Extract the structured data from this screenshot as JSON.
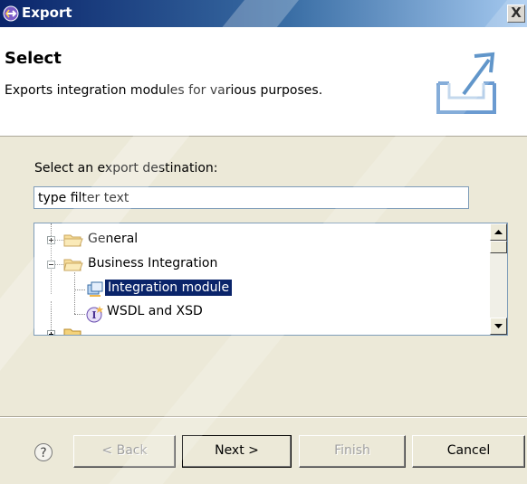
{
  "window": {
    "title": "Export",
    "close_label": "X"
  },
  "banner": {
    "title": "Select",
    "description": "Exports integration modules for various purposes."
  },
  "destination": {
    "label": "Select an export destination:",
    "filter_value": "type filter text"
  },
  "tree": {
    "items": [
      {
        "label": "General",
        "icon": "folder-icon",
        "expanded": false,
        "selected": false
      },
      {
        "label": "Business Integration",
        "icon": "folder-open-icon",
        "expanded": true,
        "selected": false
      },
      {
        "label": "Integration module",
        "icon": "integration-module-icon",
        "selected": true
      },
      {
        "label": "WSDL and XSD",
        "icon": "wsdl-icon",
        "selected": false
      }
    ]
  },
  "buttons": {
    "back": "< Back",
    "next": "Next >",
    "finish": "Finish",
    "cancel": "Cancel"
  },
  "colors": {
    "title_bar": "#0a246a",
    "selection": "#0a246a",
    "dialog_bg": "#ece9d8"
  }
}
